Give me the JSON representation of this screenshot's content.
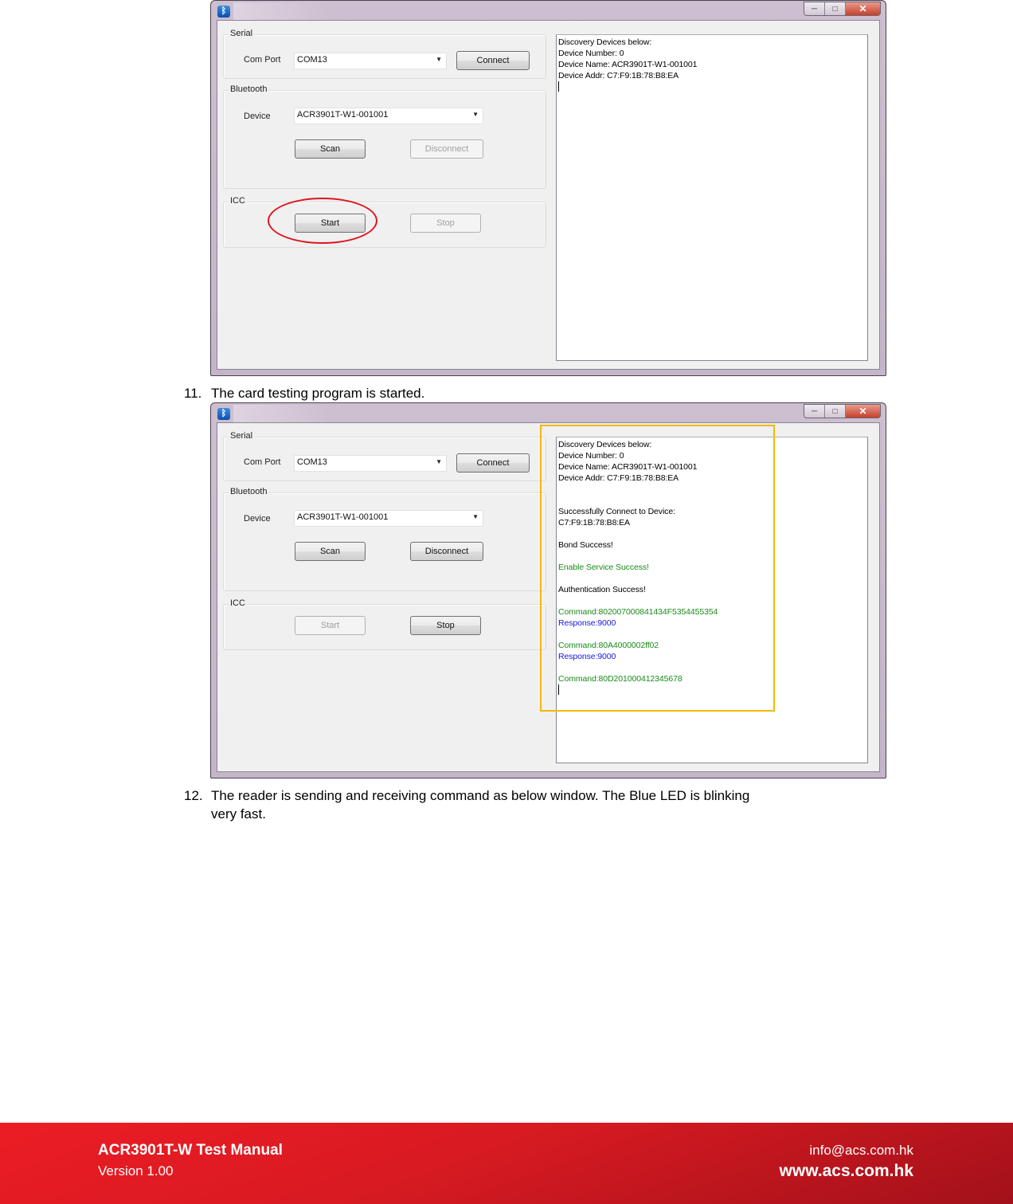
{
  "screenshot1": {
    "window_icon": "bluetooth-icon",
    "window_controls": {
      "minimize": "─",
      "maximize": "□",
      "close": "✕"
    },
    "serial": {
      "group_label": "Serial",
      "com_port_label": "Com Port",
      "com_port_value": "COM13",
      "connect_button": "Connect"
    },
    "bluetooth": {
      "group_label": "Bluetooth",
      "device_label": "Device",
      "device_value": "ACR3901T-W1-001001",
      "scan_button": "Scan",
      "disconnect_button": "Disconnect",
      "disconnect_enabled": false
    },
    "icc": {
      "group_label": "ICC",
      "start_button": "Start",
      "stop_button": "Stop",
      "start_enabled": true,
      "stop_enabled": false
    },
    "log_lines": [
      {
        "text": "Discovery Devices below:",
        "color": "black"
      },
      {
        "text": "Device Number: 0",
        "color": "black"
      },
      {
        "text": "Device Name: ACR3901T-W1-001001",
        "color": "black"
      },
      {
        "text": "Device Addr: C7:F9:1B:78:B8:EA",
        "color": "black"
      }
    ],
    "annotation": "red-circle-around-start"
  },
  "step11": {
    "number": "11.",
    "text": "The card testing program is started."
  },
  "screenshot2": {
    "window_icon": "bluetooth-icon",
    "window_controls": {
      "minimize": "─",
      "maximize": "□",
      "close": "✕"
    },
    "serial": {
      "group_label": "Serial",
      "com_port_label": "Com Port",
      "com_port_value": "COM13",
      "connect_button": "Connect"
    },
    "bluetooth": {
      "group_label": "Bluetooth",
      "device_label": "Device",
      "device_value": "ACR3901T-W1-001001",
      "scan_button": "Scan",
      "disconnect_button": "Disconnect",
      "disconnect_enabled": true
    },
    "icc": {
      "group_label": "ICC",
      "start_button": "Start",
      "stop_button": "Stop",
      "start_enabled": false,
      "stop_enabled": true
    },
    "log_lines": [
      {
        "text": "Discovery Devices below:",
        "color": "black"
      },
      {
        "text": "Device Number: 0",
        "color": "black"
      },
      {
        "text": "Device Name: ACR3901T-W1-001001",
        "color": "black"
      },
      {
        "text": "Device Addr: C7:F9:1B:78:B8:EA",
        "color": "black"
      },
      {
        "text": "",
        "color": "black"
      },
      {
        "text": "",
        "color": "black"
      },
      {
        "text": "Successfully Connect to Device:",
        "color": "black"
      },
      {
        "text": "C7:F9:1B:78:B8:EA",
        "color": "black"
      },
      {
        "text": "",
        "color": "black"
      },
      {
        "text": "Bond Success!",
        "color": "black"
      },
      {
        "text": "",
        "color": "black"
      },
      {
        "text": "Enable Service Success!",
        "color": "green"
      },
      {
        "text": "",
        "color": "black"
      },
      {
        "text": "Authentication Success!",
        "color": "black"
      },
      {
        "text": "",
        "color": "black"
      },
      {
        "text": "Command:802007000841434F5354455354",
        "color": "green"
      },
      {
        "text": "Response:9000",
        "color": "blue"
      },
      {
        "text": "",
        "color": "black"
      },
      {
        "text": "Command:80A4000002ff02",
        "color": "green"
      },
      {
        "text": "Response:9000",
        "color": "blue"
      },
      {
        "text": "",
        "color": "black"
      },
      {
        "text": "Command:80D201000412345678",
        "color": "green"
      }
    ],
    "annotation": "yellow-rectangle-around-log"
  },
  "step12": {
    "number": "12.",
    "text_line1": "The reader is sending and receiving command as below window. The Blue LED is blinking",
    "text_line2": "very fast."
  },
  "footer": {
    "title": "ACR3901T-W Test Manual",
    "version": "Version 1.00",
    "email": "info@acs.com.hk",
    "website": "www.acs.com.hk"
  },
  "colors": {
    "log_green": "#1a8a1a",
    "log_blue": "#1818e0",
    "annotation_red": "#e0141e",
    "annotation_yellow": "#f5b800",
    "footer_red": "#ec1c24"
  }
}
